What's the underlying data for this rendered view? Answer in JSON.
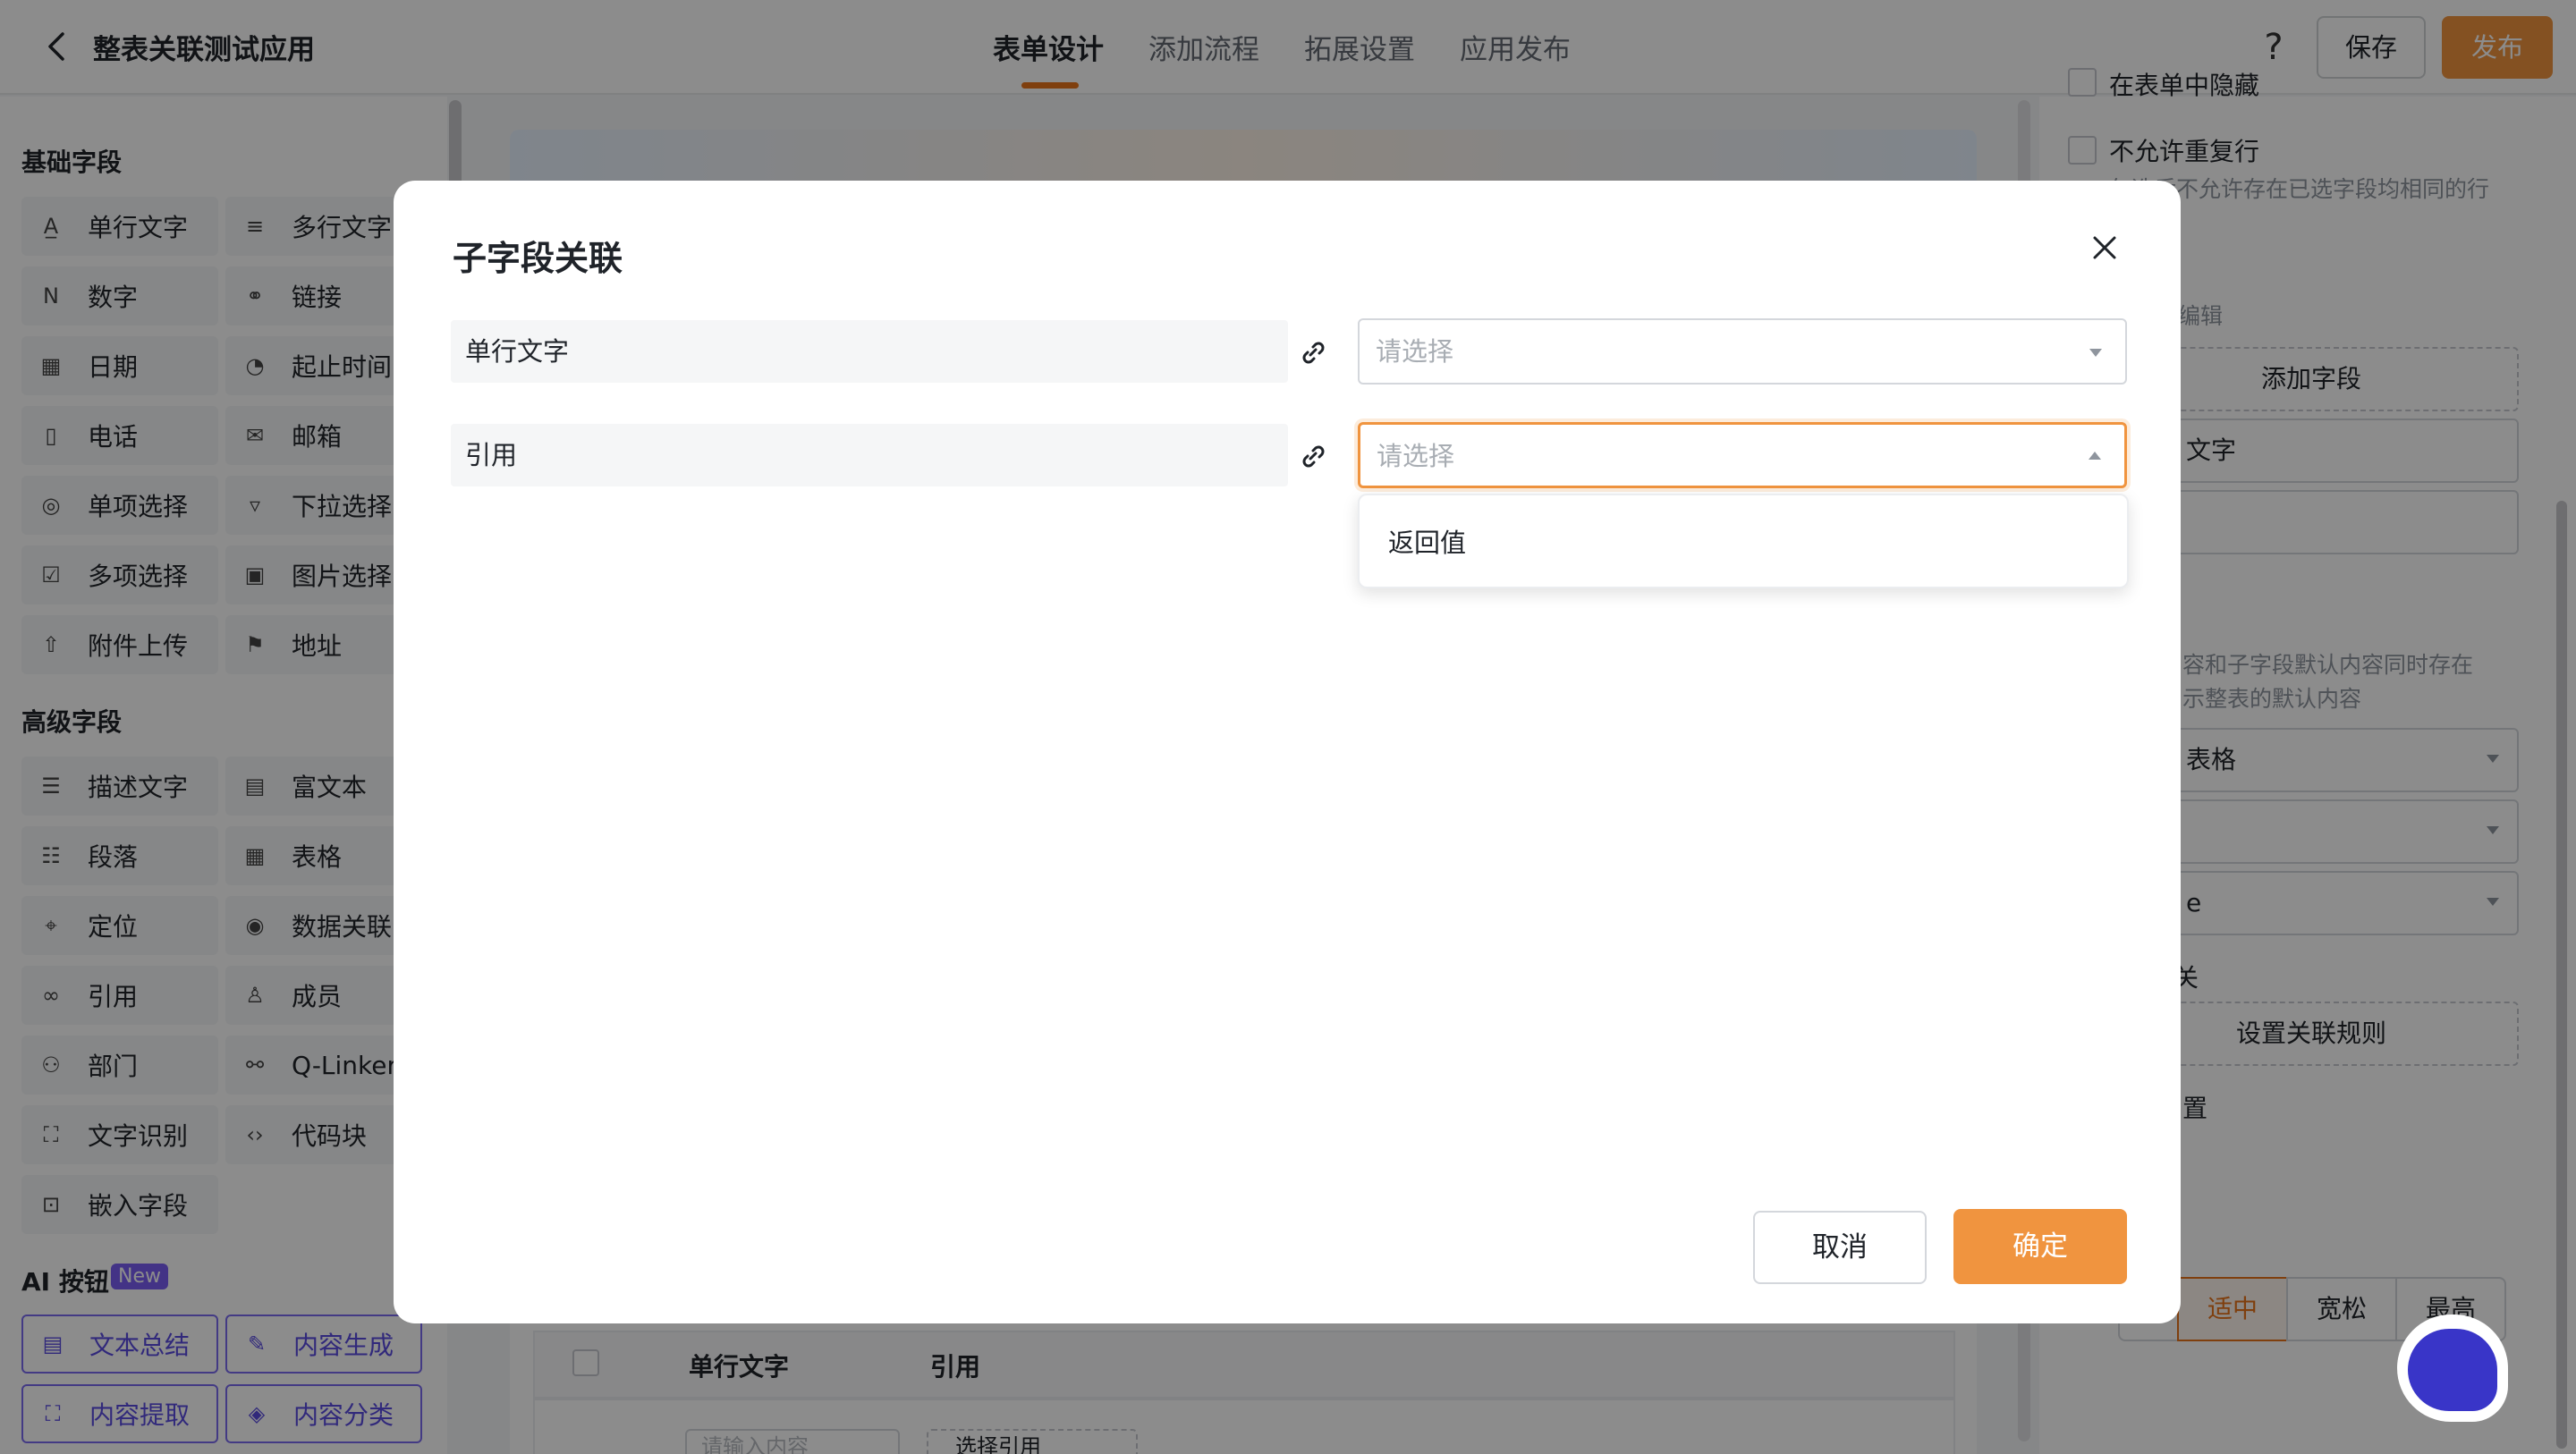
{
  "header": {
    "app_title": "整表关联测试应用",
    "tabs": [
      {
        "label": "表单设计",
        "active": true
      },
      {
        "label": "添加流程",
        "active": false
      },
      {
        "label": "拓展设置",
        "active": false
      },
      {
        "label": "应用发布",
        "active": false
      }
    ],
    "help_glyph": "?",
    "save_label": "保存",
    "publish_label": "发布"
  },
  "left_panel": {
    "basic_section": "基础字段",
    "basic_fields": [
      {
        "label": "单行文字",
        "icon": "text-a-icon"
      },
      {
        "label": "多行文字",
        "icon": "multiline-text-icon"
      },
      {
        "label": "数字",
        "icon": "number-icon"
      },
      {
        "label": "链接",
        "icon": "link-icon"
      },
      {
        "label": "日期",
        "icon": "calendar-icon"
      },
      {
        "label": "起止时间",
        "icon": "time-range-icon"
      },
      {
        "label": "电话",
        "icon": "phone-icon"
      },
      {
        "label": "邮箱",
        "icon": "mail-icon"
      },
      {
        "label": "单项选择",
        "icon": "radio-icon"
      },
      {
        "label": "下拉选择",
        "icon": "dropdown-icon"
      },
      {
        "label": "多项选择",
        "icon": "checkbox-icon"
      },
      {
        "label": "图片选择",
        "icon": "image-icon"
      },
      {
        "label": "附件上传",
        "icon": "upload-icon"
      },
      {
        "label": "地址",
        "icon": "signpost-icon"
      }
    ],
    "advanced_section": "高级字段",
    "advanced_fields": [
      {
        "label": "描述文字",
        "icon": "description-icon"
      },
      {
        "label": "富文本",
        "icon": "rich-text-icon"
      },
      {
        "label": "段落",
        "icon": "paragraph-icon"
      },
      {
        "label": "表格",
        "icon": "table-icon"
      },
      {
        "label": "定位",
        "icon": "location-icon"
      },
      {
        "label": "数据关联",
        "icon": "data-link-icon"
      },
      {
        "label": "引用",
        "icon": "reference-icon"
      },
      {
        "label": "成员",
        "icon": "member-icon"
      },
      {
        "label": "部门",
        "icon": "department-icon"
      },
      {
        "label": "Q-Linker",
        "icon": "qlinker-icon"
      },
      {
        "label": "文字识别",
        "icon": "ocr-icon"
      },
      {
        "label": "代码块",
        "icon": "code-icon"
      },
      {
        "label": "嵌入字段",
        "icon": "embed-icon"
      }
    ],
    "ai_section": "AI 按钮",
    "ai_badge": "New",
    "ai_buttons": [
      {
        "label": "文本总结",
        "icon": "summary-icon"
      },
      {
        "label": "内容生成",
        "icon": "generate-icon"
      },
      {
        "label": "内容提取",
        "icon": "extract-icon"
      },
      {
        "label": "内容分类",
        "icon": "classify-icon"
      }
    ]
  },
  "canvas": {
    "table_headers": [
      "单行文字",
      "引用"
    ],
    "row_input_placeholder": "请输入内容",
    "row_ref_label": "选择引用"
  },
  "right_panel": {
    "hide_label": "在表单中隐藏",
    "no_duplicate_label": "不允许重复行",
    "no_duplicate_hint": "勾选后不允许存在已选字段均相同的行",
    "row_edit_label": "行编辑",
    "add_field": "添加字段",
    "field_box_1": "文字",
    "default_hint_1": "容和子字段默认内容同时存在",
    "default_hint_2": "示整表的默认内容",
    "select_1": "表格",
    "select_3": "e",
    "link_label": "关",
    "set_rule": "设置关联规则",
    "config_label": "置",
    "segments": [
      "适中",
      "宽松",
      "最高"
    ],
    "active_segment": "适中"
  },
  "modal": {
    "title": "子字段关联",
    "rows": [
      {
        "source": "单行文字",
        "placeholder": "请选择",
        "focused": false
      },
      {
        "source": "引用",
        "placeholder": "请选择",
        "focused": true
      }
    ],
    "dropdown_options": [
      "返回值"
    ],
    "cancel_label": "取消",
    "confirm_label": "确定"
  },
  "colors": {
    "accent": "#f0943f",
    "ai_purple": "#7a6bf0",
    "assistant_blue": "#3935c8"
  }
}
